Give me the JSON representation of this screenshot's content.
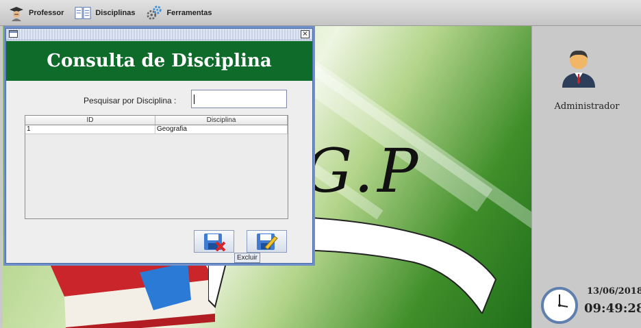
{
  "menu": {
    "items": [
      {
        "label": "Professor",
        "icon": "professor-icon"
      },
      {
        "label": "Disciplinas",
        "icon": "books-icon"
      },
      {
        "label": "Ferramentas",
        "icon": "gears-icon"
      }
    ]
  },
  "background": {
    "logo_text": "G.P"
  },
  "right_panel": {
    "user_label": "Administrador",
    "date": "13/06/2018",
    "time": "09:49:28"
  },
  "window": {
    "title": "Consulta de Disciplina",
    "search_label": "Pesquisar por Disciplina :",
    "search_value": "",
    "table": {
      "columns": [
        "ID",
        "Disciplina"
      ],
      "rows": [
        [
          "1",
          "Geografia"
        ]
      ]
    },
    "buttons": {
      "delete_tooltip": "Excluir"
    }
  },
  "colors": {
    "banner": "#0f6b2a",
    "frame_border": "#6e8fc8"
  }
}
